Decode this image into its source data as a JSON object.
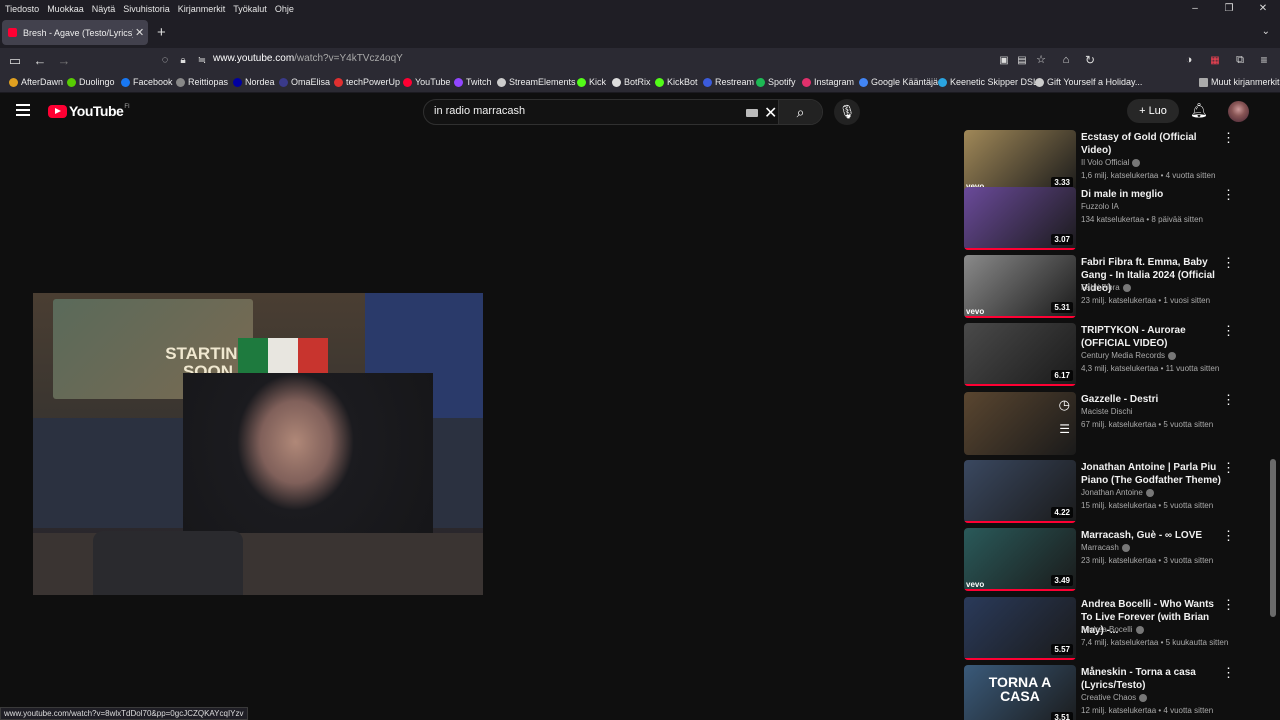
{
  "menu": [
    "Tiedosto",
    "Muokkaa",
    "Näytä",
    "Sivuhistoria",
    "Kirjanmerkit",
    "Työkalut",
    "Ohje"
  ],
  "tab": {
    "title": "Bresh - Agave (Testo/Lyrics) - Yo"
  },
  "url": {
    "domain": "www.youtube.com",
    "path": "/watch?v=Y4kTVcz4oqY"
  },
  "bookmarks": [
    {
      "label": "AfterDawn",
      "color": "#e0a020"
    },
    {
      "label": "Duolingo",
      "color": "#58cc02"
    },
    {
      "label": "Facebook",
      "color": "#1877f2"
    },
    {
      "label": "Reittiopas",
      "color": "#888888"
    },
    {
      "label": "Nordea",
      "color": "#0000a0"
    },
    {
      "label": "OmaElisa",
      "color": "#3a3a8a"
    },
    {
      "label": "techPowerUp",
      "color": "#e03030"
    },
    {
      "label": "YouTube",
      "color": "#ff0033"
    },
    {
      "label": "Twitch",
      "color": "#9146ff"
    },
    {
      "label": "StreamElements",
      "color": "#cccccc"
    },
    {
      "label": "Kick",
      "color": "#53fc18"
    },
    {
      "label": "BotRix",
      "color": "#dddddd"
    },
    {
      "label": "KickBot",
      "color": "#53fc18"
    },
    {
      "label": "Restream",
      "color": "#3b5bdb"
    },
    {
      "label": "Spotify",
      "color": "#1db954"
    },
    {
      "label": "Instagram",
      "color": "#e1306c"
    },
    {
      "label": "Google Kääntäjä",
      "color": "#4285f4"
    },
    {
      "label": "Keenetic Skipper DSL",
      "color": "#2aa4e0"
    },
    {
      "label": "Gift Yourself a Holiday...",
      "color": "#cccccc"
    }
  ],
  "other_bookmarks": "Muut kirjanmerkit",
  "header": {
    "logo": "YouTube",
    "region": "FI",
    "search_value": "in radio marracash",
    "create_label": "Luo"
  },
  "recommendations": [
    {
      "title": "Ecstasy of Gold (Official Video)",
      "channel": "Il Volo Official",
      "meta": "1,6 milj. katselukertaa • 4 vuotta sitten",
      "duration": "3.33",
      "vevo": true,
      "thumb": "#a08858"
    },
    {
      "title": "Di male in meglio",
      "channel": "Fuzzolo IA",
      "meta": "134 katselukertaa • 8 päivää sitten",
      "duration": "3.07",
      "vevo": false,
      "thumb": "#6a4a9a"
    },
    {
      "title": "Fabri Fibra ft. Emma, Baby Gang - In Italia 2024 (Official Video)",
      "channel": "Fabri Fibra",
      "meta": "23 milj. katselukertaa • 1 vuosi sitten",
      "duration": "5.31",
      "vevo": true,
      "thumb": "#8a8a8a"
    },
    {
      "title": "TRIPTYKON - Aurorae (OFFICIAL VIDEO)",
      "channel": "Century Media Records",
      "meta": "4,3 milj. katselukertaa • 11 vuotta sitten",
      "duration": "6.17",
      "vevo": false,
      "thumb": "#4a4a4a"
    },
    {
      "title": "Gazzelle - Destri",
      "channel": "Maciste Dischi",
      "meta": "67 milj. katselukertaa • 5 vuotta sitten",
      "duration": "",
      "vevo": false,
      "thumb": "#5a4630"
    },
    {
      "title": "Jonathan Antoine | Parla Piu Piano (The Godfather Theme)",
      "channel": "Jonathan Antoine",
      "meta": "15 milj. katselukertaa • 5 vuotta sitten",
      "duration": "4.22",
      "vevo": false,
      "thumb": "#3a4860"
    },
    {
      "title": "Marracash, Guè - ∞ LOVE",
      "channel": "Marracash",
      "meta": "23 milj. katselukertaa • 3 vuotta sitten",
      "duration": "3.49",
      "vevo": true,
      "thumb": "#2a5a5a"
    },
    {
      "title": "Andrea Bocelli - Who Wants To Live Forever (with Brian May) -...",
      "channel": "Andrea Bocelli",
      "meta": "7,4 milj. katselukertaa • 5 kuukautta sitten",
      "duration": "5.57",
      "vevo": false,
      "thumb": "#2a3a5a"
    },
    {
      "title": "Måneskin - Torna a casa (Lyrics/Testo)",
      "channel": "Creative Chaos",
      "meta": "12 milj. katselukertaa • 4 vuotta sitten",
      "duration": "3.51",
      "vevo": false,
      "thumb": "#3a5a7a"
    }
  ],
  "thumb_overlay": "TORNA A CASA",
  "video_overlay_text": "STARTING SOON",
  "status_url": "www.youtube.com/watch?v=8wlxTdDol70&pp=0gcJCZQKAYcqIYzv"
}
